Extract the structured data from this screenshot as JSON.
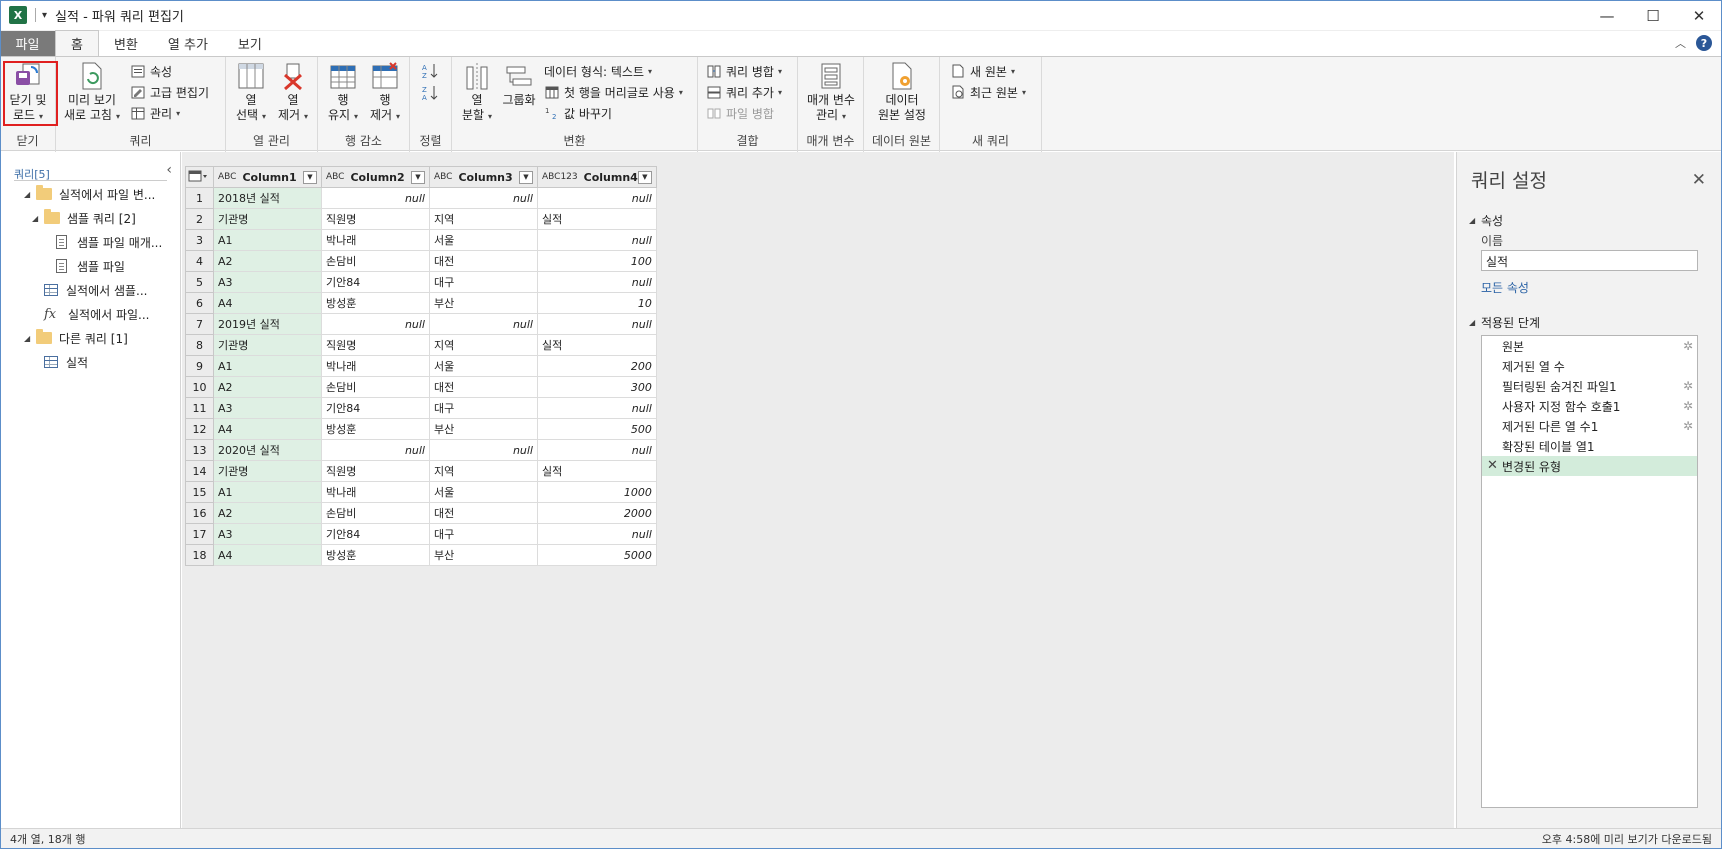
{
  "window": {
    "app_logo": "X",
    "title": "실적 - 파워 쿼리 편집기",
    "minimize": "—",
    "maximize": "☐",
    "close": "✕"
  },
  "tabs": [
    {
      "label": "파일"
    },
    {
      "label": "홈"
    },
    {
      "label": "변환"
    },
    {
      "label": "열 추가"
    },
    {
      "label": "보기"
    }
  ],
  "ribbon": {
    "close_load": {
      "line1": "닫기 및",
      "line2": "로드",
      "group": "닫기"
    },
    "query": {
      "preview_refresh_l1": "미리 보기",
      "preview_refresh_l2": "새로 고침",
      "properties": "속성",
      "advanced_editor": "고급 편집기",
      "manage": "관리",
      "group": "쿼리"
    },
    "columns": {
      "choose_l1": "열",
      "choose_l2": "선택",
      "remove_l1": "열",
      "remove_l2": "제거",
      "group": "열 관리"
    },
    "rows": {
      "keep_l1": "행",
      "keep_l2": "유지",
      "remove_l1": "행",
      "remove_l2": "제거",
      "group": "행 감소"
    },
    "sort": {
      "group": "정렬"
    },
    "transform": {
      "split_l1": "열",
      "split_l2": "분할",
      "group_by": "그룹화",
      "data_type": "데이터 형식: 텍스트",
      "first_row_header": "첫 행을 머리글로 사용",
      "replace_values": "값 바꾸기",
      "group": "변환"
    },
    "combine": {
      "merge": "쿼리 병합",
      "append": "쿼리 추가",
      "combine_files": "파일 병합",
      "group": "결합"
    },
    "parameters": {
      "l1": "매개 변수",
      "l2": "관리",
      "group": "매개 변수"
    },
    "datasource": {
      "l1": "데이터",
      "l2": "원본 설정",
      "group": "데이터 원본"
    },
    "newquery": {
      "new_source": "새 원본",
      "recent_source": "최근 원본",
      "group": "새 쿼리"
    }
  },
  "nav": {
    "header": "쿼리[5]",
    "items": [
      {
        "label": "실적에서 파일 변..."
      },
      {
        "label": "샘플 쿼리 [2]"
      },
      {
        "label": "샘플 파일 매개..."
      },
      {
        "label": "샘플 파일"
      },
      {
        "label": "실적에서 샘플..."
      },
      {
        "label": "실적에서 파일..."
      },
      {
        "label": "다른 쿼리 [1]"
      },
      {
        "label": "실적"
      }
    ]
  },
  "grid": {
    "columns": [
      {
        "name": "Column1",
        "type": "ABC"
      },
      {
        "name": "Column2",
        "type": "ABC"
      },
      {
        "name": "Column3",
        "type": "ABC"
      },
      {
        "name": "Column4",
        "type": "ABC123"
      }
    ],
    "rows": [
      [
        "1",
        "2018년 실적",
        "null",
        "null",
        "null"
      ],
      [
        "2",
        "기관명",
        "직원명",
        "지역",
        "실적"
      ],
      [
        "3",
        "A1",
        "박나래",
        "서울",
        "null"
      ],
      [
        "4",
        "A2",
        "손담비",
        "대전",
        "100"
      ],
      [
        "5",
        "A3",
        "기안84",
        "대구",
        "null"
      ],
      [
        "6",
        "A4",
        "방성훈",
        "부산",
        "10"
      ],
      [
        "7",
        "2019년 실적",
        "null",
        "null",
        "null"
      ],
      [
        "8",
        "기관명",
        "직원명",
        "지역",
        "실적"
      ],
      [
        "9",
        "A1",
        "박나래",
        "서울",
        "200"
      ],
      [
        "10",
        "A2",
        "손담비",
        "대전",
        "300"
      ],
      [
        "11",
        "A3",
        "기안84",
        "대구",
        "null"
      ],
      [
        "12",
        "A4",
        "방성훈",
        "부산",
        "500"
      ],
      [
        "13",
        "2020년 실적",
        "null",
        "null",
        "null"
      ],
      [
        "14",
        "기관명",
        "직원명",
        "지역",
        "실적"
      ],
      [
        "15",
        "A1",
        "박나래",
        "서울",
        "1000"
      ],
      [
        "16",
        "A2",
        "손담비",
        "대전",
        "2000"
      ],
      [
        "17",
        "A3",
        "기안84",
        "대구",
        "null"
      ],
      [
        "18",
        "A4",
        "방성훈",
        "부산",
        "5000"
      ]
    ]
  },
  "settings": {
    "title": "쿼리 설정",
    "properties_header": "속성",
    "name_label": "이름",
    "name_value": "실적",
    "all_properties": "모든 속성",
    "steps_header": "적용된 단계",
    "steps": [
      {
        "label": "원본",
        "gear": true
      },
      {
        "label": "제거된 열 수",
        "gear": false
      },
      {
        "label": "필터링된 숨겨진 파일1",
        "gear": true
      },
      {
        "label": "사용자 지정 함수 호출1",
        "gear": true
      },
      {
        "label": "제거된 다른 열 수1",
        "gear": true
      },
      {
        "label": "확장된 테이블 열1",
        "gear": false
      },
      {
        "label": "변경된 유형",
        "gear": false,
        "selected": true
      }
    ]
  },
  "status": {
    "left": "4개 열, 18개 행",
    "right": "오후 4:58에 미리 보기가 다운로드됨"
  }
}
